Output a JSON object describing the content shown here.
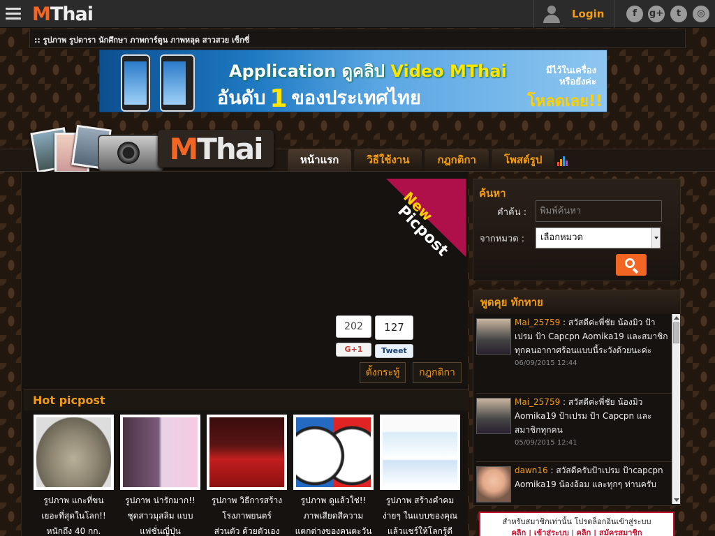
{
  "topbar": {
    "logo_m": "M",
    "logo_text": "Thai",
    "login_label": "Login",
    "social": [
      {
        "icon": "facebook-icon",
        "glyph": "f"
      },
      {
        "icon": "google-plus-icon",
        "glyph": "g+"
      },
      {
        "icon": "twitter-icon",
        "glyph": "t"
      },
      {
        "icon": "instagram-icon",
        "glyph": "◎"
      }
    ]
  },
  "keywords": ":: รูปภาพ รูปดารา นักศึกษา ภาพการ์ตูน ภาพหลุด สาวสวย เซ็กซี่",
  "banner": {
    "line1_a": "Application ดูคลิป ",
    "line1_b": "Video MThai",
    "line2_a": "อันดับ",
    "line2_num": "1",
    "line2_b": "ของประเทศไทย",
    "side_text": "มีไว้ในเครื่อง หรือยังค่ะ",
    "cta": "โหลดเลย!!"
  },
  "header": {
    "logo_m": "M",
    "logo_text": "Thai",
    "tabs": [
      "หน้าแรก",
      "วิธีใช้งาน",
      "กฎกติกา",
      "โพสต์รูป"
    ]
  },
  "ribbon": {
    "new": "New",
    "picpost": "Picpost"
  },
  "share": {
    "gplus_count": "202",
    "gplus_label": "G+1",
    "tweet_count": "127",
    "tweet_label": "Tweet"
  },
  "actions": {
    "setup_label": "ตั้งกระทู้",
    "rules_label": "กฎกติกา"
  },
  "hot": {
    "title": "Hot picpost",
    "items": [
      {
        "line1": "รูปภาพ แกะที่ขน",
        "line2": "เยอะที่สุดในโลก!!",
        "line3": "หนักถึง 40 กก."
      },
      {
        "line1": "รูปภาพ น่ารักมาก!!",
        "line2": "ชุดสาวมุสลิม แบบ",
        "line3": "แฟชั่นญี่ปุ่น"
      },
      {
        "line1": "รูปภาพ วิธีการสร้าง",
        "line2": "โรงภาพยนตร์",
        "line3": "ส่วนตัว ด้วยตัวเอง"
      },
      {
        "line1": "รูปภาพ ดูแล้วใช่!!",
        "line2": "ภาพเสียดสีความ",
        "line3": "แตกต่างของคนตะวัน"
      },
      {
        "line1": "รูปภาพ สร้างคำคม",
        "line2": "ง่ายๆ ในแบบของคุณ",
        "line3": "แล้วแชร์ให้โลกรู้ดี"
      }
    ]
  },
  "search": {
    "title": "ค้นหา",
    "keyword_label": "คำค้น :",
    "placeholder": "พิมพ์ค้นหา",
    "category_label": "จากหมวด :",
    "category_value": "เลือกหมวด"
  },
  "chat": {
    "title": "พูดคุย ทักทาย",
    "messages": [
      {
        "name": "Mai_25759",
        "sep": " : ",
        "text": "สวัสดีค่ะพี่ชัย น้องมิว ป้าเปรม ป้า Capcpn Aomika19 และสมาชิกทุกคนอากาศร้อนแบบนี้ระวังด้วยนะค่ะ",
        "time": "06/09/2015 12:44"
      },
      {
        "name": "Mai_25759",
        "sep": " : ",
        "text": "สวัสดีค่ะพี่ชัย น้องมิว Aomika19 ป้าเปรม ป้า Capcpn และสมาชิกทุกคน",
        "time": "05/09/2015 12:41"
      },
      {
        "name": "dawn16",
        "sep": " : ",
        "text": "สวัสดีครับป้าเปรม ป้าcapcpn Aomika19 น้องอ้อม และทุกๆ ท่านครับ",
        "time": ""
      }
    ]
  },
  "member_note": {
    "line1": "สำหรับสมาชิกเท่านั้น โปรดล็อกอินเข้าสู่ระบบ",
    "login_link": "คลิก | เข้าสู่ระบบ",
    "sep": " | ",
    "register_link": "คลิก | สมัครสมาชิก"
  },
  "colors": {
    "accent": "#f39c12",
    "brand": "#f26522",
    "ribbon": "#b0104a"
  }
}
